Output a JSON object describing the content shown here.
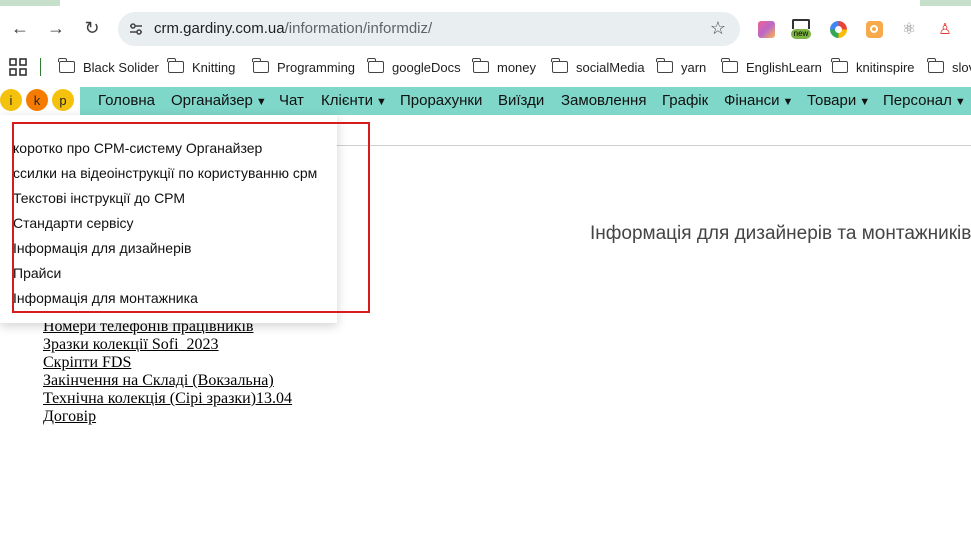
{
  "browser": {
    "url_host": "crm.gardiny.com.ua",
    "url_path": "/information/informdiz/",
    "extensions": [
      {
        "name": "pink-square-extension-icon",
        "color": "#d94fa0"
      },
      {
        "name": "new-badge-extension-icon",
        "badge": "new",
        "color": "#2e7d32"
      },
      {
        "name": "color-wheel-extension-icon",
        "color": "#4285f4"
      },
      {
        "name": "orange-extension-icon",
        "color": "#f08a24"
      },
      {
        "name": "gear-extension-icon",
        "color": "#888888"
      },
      {
        "name": "person-extension-icon",
        "color": "#e53935"
      }
    ]
  },
  "bookmarks": [
    {
      "label": "Black Solider"
    },
    {
      "label": "Knitting"
    },
    {
      "label": "Programming"
    },
    {
      "label": "googleDocs"
    },
    {
      "label": "money"
    },
    {
      "label": "socialMedia"
    },
    {
      "label": "yarn"
    },
    {
      "label": "EnglishLearn"
    },
    {
      "label": "knitinspire"
    },
    {
      "label": "slov"
    }
  ],
  "logo": {
    "letters": [
      {
        "char": "i",
        "color": "#f4c20d"
      },
      {
        "char": "k",
        "color": "#f57c00"
      },
      {
        "char": "p",
        "color": "#f4c20d"
      }
    ]
  },
  "nav": [
    {
      "label": "Головна",
      "caret": ""
    },
    {
      "label": "Органайзер",
      "caret": "▼"
    },
    {
      "label": "Чат",
      "caret": ""
    },
    {
      "label": "Клієнти",
      "caret": "▼"
    },
    {
      "label": "Прорахунки",
      "caret": ""
    },
    {
      "label": "Виїзди",
      "caret": ""
    },
    {
      "label": "Замовлення",
      "caret": ""
    },
    {
      "label": "Графік",
      "caret": ""
    },
    {
      "label": "Фінанси",
      "caret": "▼"
    },
    {
      "label": "Товари",
      "caret": "▼"
    },
    {
      "label": "Персонал",
      "caret": "▼"
    }
  ],
  "dropdown": {
    "items": [
      "коротко про СРМ-систему Органайзер",
      "ссилки на відеоінструкції по користуванню срм",
      "Текстові інструкції до СРМ",
      "Стандарти сервісу",
      "Інформація для дизайнерів",
      "Прайси",
      "Інформація для монтажника"
    ]
  },
  "main": {
    "title": "Інформація для дизайнерів та монтажників",
    "links": [
      "Номери телефонів працівників",
      "Зразки колекції Sofi_2023",
      "Скріпти FDS",
      "Закінчення на Складі (Вокзальна)",
      "Технічна колекція (Сірі зразки)13.04",
      "Договір"
    ]
  }
}
